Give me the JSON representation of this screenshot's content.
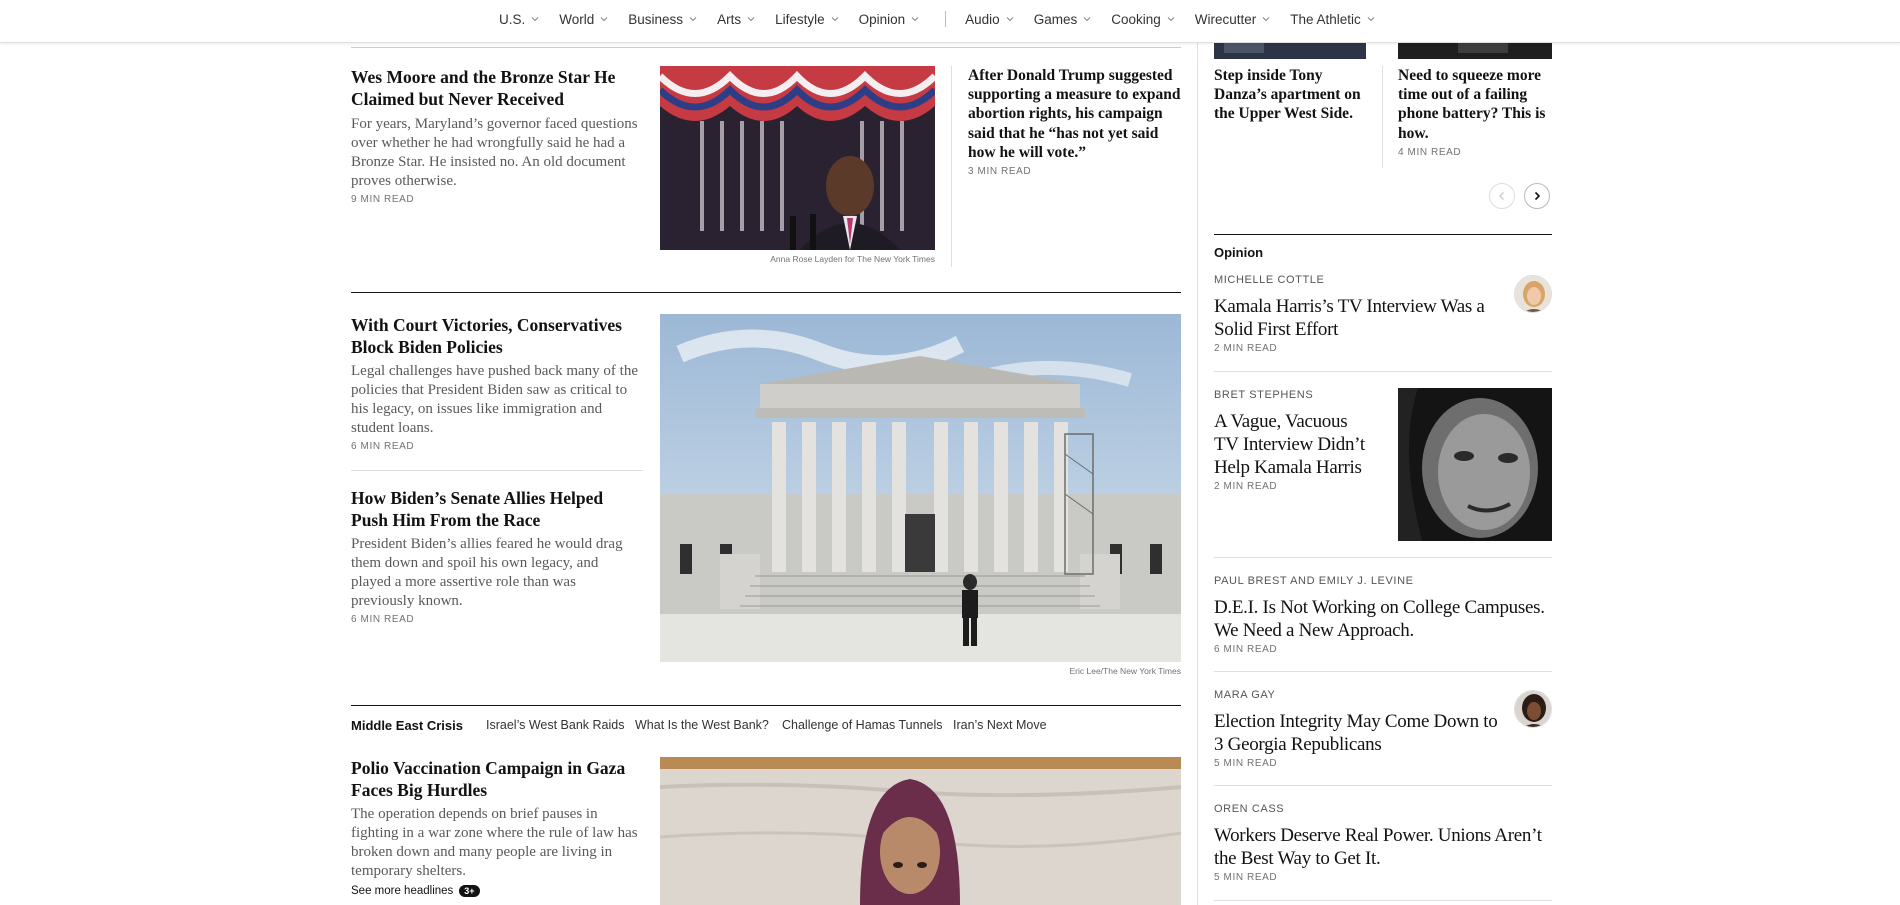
{
  "nav": {
    "items": [
      "U.S.",
      "World",
      "Business",
      "Arts",
      "Lifestyle",
      "Opinion"
    ],
    "items2": [
      "Audio",
      "Games",
      "Cooking",
      "Wirecutter",
      "The Athletic"
    ]
  },
  "story1": {
    "headline": "Wes Moore and the Bronze Star He Claimed but Never Received",
    "summary": "For years, Maryland’s governor faced questions over whether he had wrongfully said he had a Bronze Star. He insisted no. An old document proves otherwise.",
    "readtime": "9 MIN READ",
    "credit": "Anna Rose Layden for The New York Times"
  },
  "story1b": {
    "headline": "After Donald Trump suggested supporting a measure to expand abortion rights, his campaign said that he “has not yet said how he will vote.”",
    "readtime": "3 MIN READ"
  },
  "story2": {
    "headline": "With Court Victories, Conservatives Block Biden Policies",
    "summary": "Legal challenges have pushed back many of the policies that President Biden saw as critical to his legacy, on issues like immigration and student loans.",
    "readtime": "6 MIN READ",
    "credit": "Eric Lee/The New York Times"
  },
  "story3": {
    "headline": "How Biden’s Senate Allies Helped Push Him From the Race",
    "summary": "President Biden’s allies feared he would drag them down and spoil his own legacy, and played a more assertive role than was previously known.",
    "readtime": "6 MIN READ"
  },
  "middle_east": {
    "label": "Middle East Crisis",
    "links": [
      "Israel’s West Bank Raids",
      "What Is the West Bank?",
      "Challenge of Hamas Tunnels",
      "Iran’s Next Move"
    ]
  },
  "story4": {
    "headline": "Polio Vaccination Campaign in Gaza Faces Big Hurdles",
    "summary": "The operation depends on brief pauses in fighting in a war zone where the rule of law has broken down and many people are living in temporary shelters.",
    "see_more": "See more headlines",
    "badge": "3+"
  },
  "right_top": {
    "item1": "Step inside Tony Danza’s apartment on the Upper West Side.",
    "item2": "Need to squeeze more time out of a failing phone battery? This is how.",
    "item2_readtime": "4 MIN READ"
  },
  "opinion": {
    "label": "Opinion",
    "items": [
      {
        "author": "MICHELLE COTTLE",
        "headline": "Kamala Harris’s TV Interview Was a Solid First Effort",
        "readtime": "2 MIN READ"
      },
      {
        "author": "BRET STEPHENS",
        "headline": "A Vague, Vacuous TV Interview Didn’t Help Kamala Harris",
        "readtime": "2 MIN READ"
      },
      {
        "author": "PAUL BREST AND EMILY J. LEVINE",
        "headline": "D.E.I. Is Not Working on College Campuses. We Need a New Approach.",
        "readtime": "6 MIN READ"
      },
      {
        "author": "MARA GAY",
        "headline": "Election Integrity May Come Down to 3 Georgia Republicans",
        "readtime": "5 MIN READ"
      },
      {
        "author": "OREN CASS",
        "headline": "Workers Deserve Real Power. Unions Aren’t the Best Way to Get It.",
        "readtime": "5 MIN READ"
      }
    ]
  },
  "icons": {
    "chevron": "chevron-down-icon",
    "prev": "chevron-left-icon",
    "next": "chevron-right-icon"
  }
}
